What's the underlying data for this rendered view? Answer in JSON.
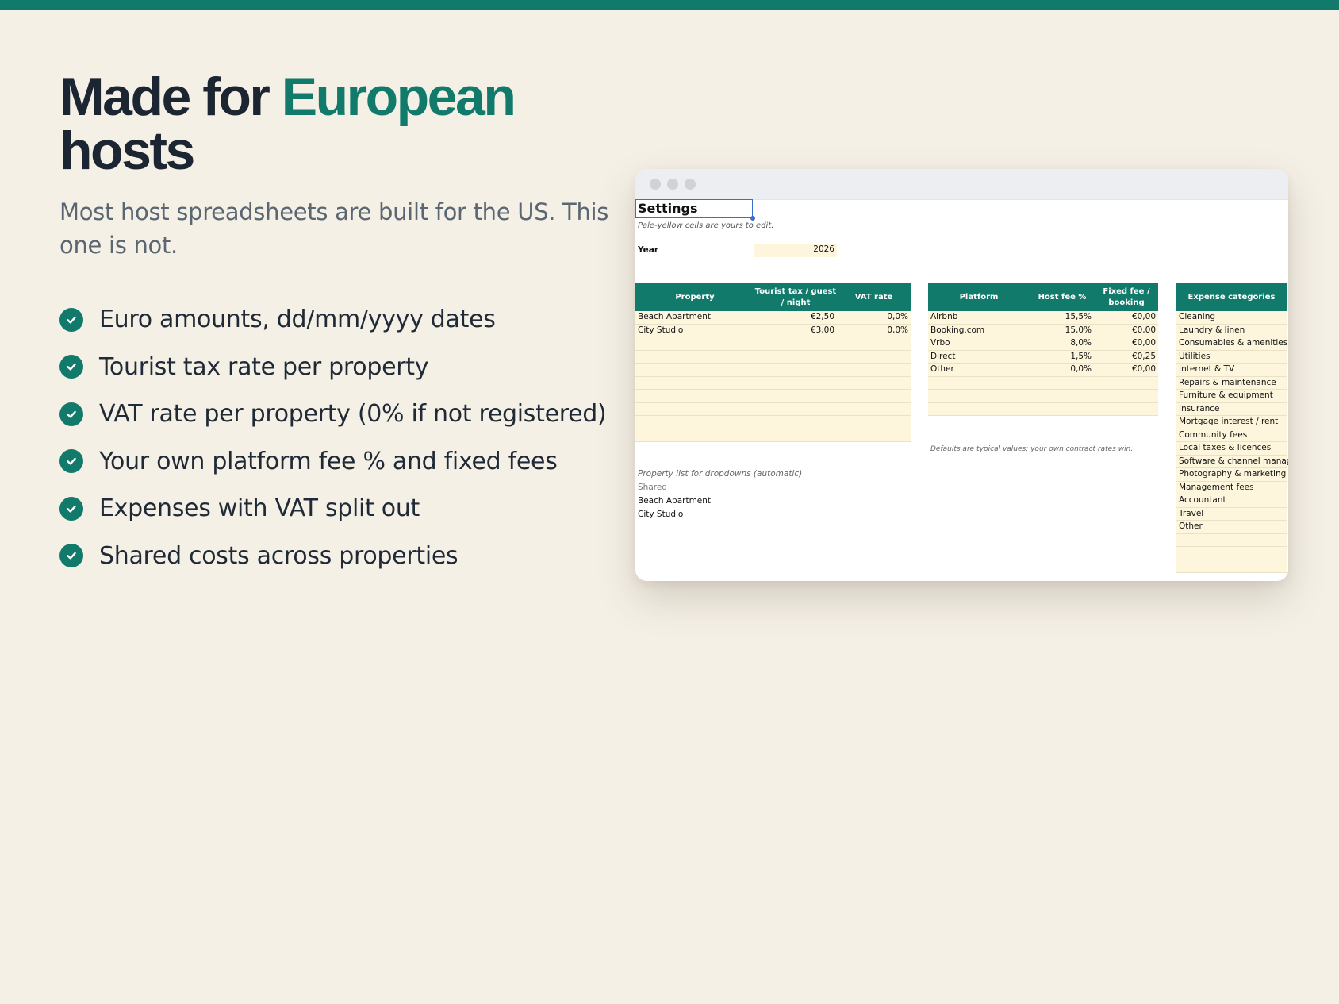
{
  "headline": {
    "part1": "Made for ",
    "accent": "European",
    "part2": "hosts"
  },
  "subtitle": "Most host spreadsheets are built for the US. This one is not.",
  "features": [
    "Euro amounts, dd/mm/yyyy dates",
    "Tourist tax rate per property",
    "VAT rate per property (0% if not registered)",
    "Your own platform fee % and fixed fees",
    "Expenses with VAT split out",
    "Shared costs across properties"
  ],
  "sheet": {
    "title": "Settings",
    "hint": "Pale-yellow cells are yours to edit.",
    "year_label": "Year",
    "year_value": "2026",
    "properties": {
      "headers": [
        "Property",
        "Tourist tax / guest / night",
        "VAT rate"
      ],
      "rows": [
        [
          "Beach Apartment",
          "€2,50",
          "0,0%"
        ],
        [
          "City Studio",
          "€3,00",
          "0,0%"
        ]
      ]
    },
    "platforms": {
      "headers": [
        "Platform",
        "Host fee %",
        "Fixed fee / booking"
      ],
      "rows": [
        [
          "Airbnb",
          "15,5%",
          "€0,00"
        ],
        [
          "Booking.com",
          "15,0%",
          "€0,00"
        ],
        [
          "Vrbo",
          "8,0%",
          "€0,00"
        ],
        [
          "Direct",
          "1,5%",
          "€0,25"
        ],
        [
          "Other",
          "0,0%",
          "€0,00"
        ]
      ],
      "note": "Defaults are typical values; your own contract rates win."
    },
    "expenses": {
      "header": "Expense categories",
      "items": [
        "Cleaning",
        "Laundry & linen",
        "Consumables & amenities",
        "Utilities",
        "Internet & TV",
        "Repairs & maintenance",
        "Furniture & equipment",
        "Insurance",
        "Mortgage interest / rent",
        "Community fees",
        "Local taxes & licences",
        "Software & channel manage",
        "Photography & marketing",
        "Management fees",
        "Accountant",
        "Travel",
        "Other"
      ]
    },
    "property_list": {
      "title": "Property list for dropdowns (automatic)",
      "items": [
        "Shared",
        "Beach Apartment",
        "City Studio"
      ]
    }
  },
  "colors": {
    "accent": "#117a6b",
    "background": "#f5f0e6",
    "editable_cell": "#fdf6dc"
  }
}
